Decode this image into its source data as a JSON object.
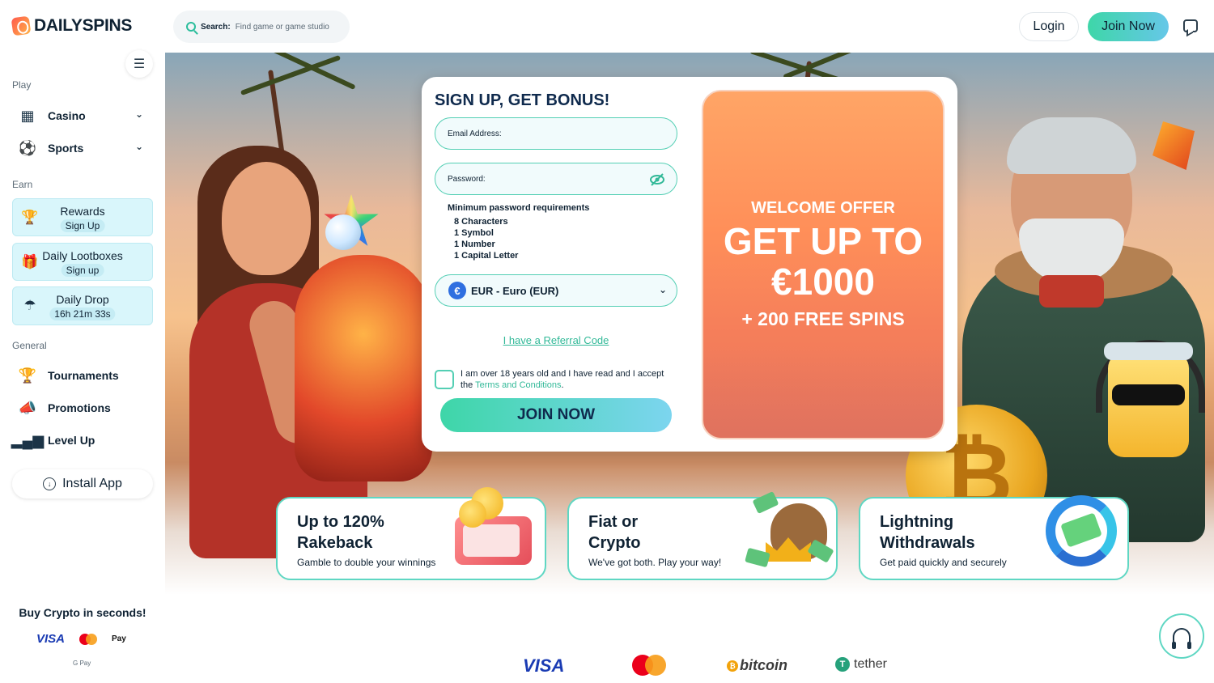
{
  "header": {
    "logo_text": "DAILYSPINS",
    "search_label": "Search:",
    "search_placeholder": "Find game or game studio",
    "login_label": "Login",
    "join_label": "Join Now"
  },
  "sidebar": {
    "play_title": "Play",
    "play_items": [
      {
        "label": "Casino",
        "icon": "slot-machine-icon"
      },
      {
        "label": "Sports",
        "icon": "soccer-ball-icon"
      }
    ],
    "earn_title": "Earn",
    "earn_items": [
      {
        "label": "Rewards",
        "sub": "Sign Up",
        "icon": "trophy-icon"
      },
      {
        "label": "Daily Lootboxes",
        "sub": "Sign up",
        "icon": "gift-icon"
      },
      {
        "label": "Daily Drop",
        "sub": "16h 21m 33s",
        "icon": "parachute-icon"
      }
    ],
    "general_title": "General",
    "general_items": [
      {
        "label": "Tournaments",
        "icon": "trophy-icon"
      },
      {
        "label": "Promotions",
        "icon": "megaphone-icon"
      },
      {
        "label": "Level Up",
        "icon": "bar-chart-icon"
      }
    ],
    "install_label": "Install App",
    "buy_title": "Buy Crypto in seconds!",
    "pay_visa": "VISA",
    "pay_apple": "Pay",
    "pay_gpay": "G Pay"
  },
  "signup": {
    "title": "SIGN UP, GET BONUS!",
    "email_label": "Email Address:",
    "password_label": "Password:",
    "req_title": "Minimum password requirements",
    "requirements": [
      "8 Characters",
      "1 Symbol",
      "1 Number",
      "1 Capital Letter"
    ],
    "currency_value": "EUR - Euro (EUR)",
    "currency_symbol": "€",
    "referral_link": "I have a Referral Code",
    "terms_text": "I am over 18 years old and I have read and I accept the",
    "terms_link": "Terms and Conditions",
    "terms_end": ".",
    "join_label": "JOIN NOW"
  },
  "offer": {
    "kicker": "WELCOME OFFER",
    "line1": "GET UP TO",
    "line2": "€1000",
    "line3": "+ 200 FREE SPINS"
  },
  "features": [
    {
      "title_1": "Up to 120%",
      "title_2": "Rakeback",
      "sub": "Gamble to double your winnings"
    },
    {
      "title_1": "Fiat or",
      "title_2": "Crypto",
      "sub": "We've got both. Play your way!"
    },
    {
      "title_1": "Lightning",
      "title_2": "Withdrawals",
      "sub": "Get paid quickly and securely"
    }
  ],
  "brands": {
    "visa": "VISA",
    "bitcoin": "bitcoin",
    "tether": "tether"
  },
  "colors": {
    "accent": "#3ed6a8",
    "accent_blue": "#66c7e8",
    "earn_card_bg": "#d9f6fb",
    "offer_orange": "#ff8f59",
    "text_dark": "#0f2233"
  }
}
